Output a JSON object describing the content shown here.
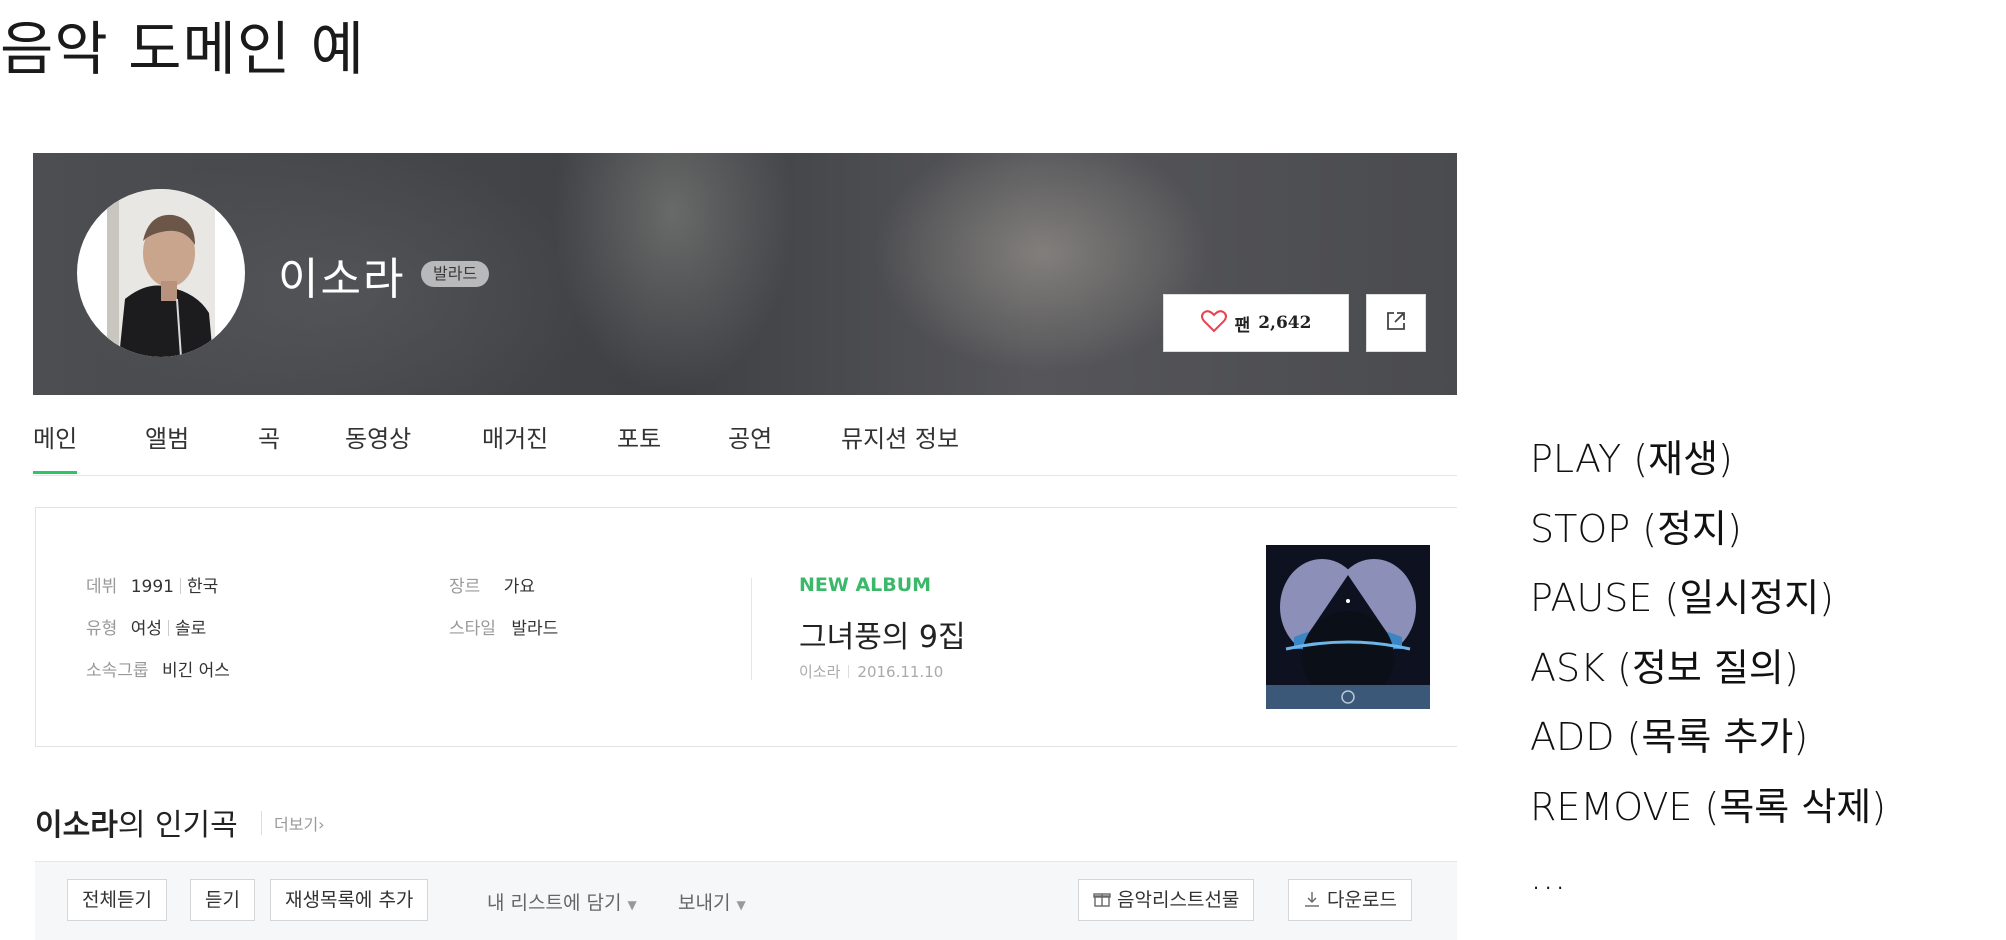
{
  "slide_title": "음악 도메인 예",
  "artist": {
    "name": "이소라",
    "genre_badge": "발라드",
    "fan_label": "팬",
    "fan_count": "2,642"
  },
  "tabs": [
    {
      "label": "메인",
      "active": true
    },
    {
      "label": "앨범"
    },
    {
      "label": "곡"
    },
    {
      "label": "동영상"
    },
    {
      "label": "매거진"
    },
    {
      "label": "포토"
    },
    {
      "label": "공연"
    },
    {
      "label": "뮤지션 정보"
    }
  ],
  "info": {
    "debut_label": "데뷔",
    "debut_year": "1991",
    "debut_country": "한국",
    "type_label": "유형",
    "type_gender": "여성",
    "type_kind": "솔로",
    "group_label": "소속그룹",
    "group_value": "비긴 어스",
    "genre_label": "장르",
    "genre_value": "가요",
    "style_label": "스타일",
    "style_value": "발라드"
  },
  "new_album": {
    "tag": "NEW ALBUM",
    "title": "그녀풍의 9집",
    "artist": "이소라",
    "date": "2016.11.10"
  },
  "popular": {
    "title_bold": "이소라",
    "title_rest": "의 인기곡",
    "more": "더보기›"
  },
  "toolbar": {
    "play_all": "전체듣기",
    "listen": "듣기",
    "add_playlist": "재생목록에 추가",
    "my_list": "내 리스트에 담기",
    "send": "보내기",
    "gift": "음악리스트선물",
    "download": "다운로드"
  },
  "commands": [
    "PLAY (재생)",
    "STOP (정지)",
    "PAUSE (일시정지)",
    "ASK (정보 질의)",
    "ADD (목록 추가)",
    "REMOVE (목록 삭제)",
    "..."
  ],
  "colors": {
    "accent_green": "#2cc66a",
    "heart_red": "#e8414f"
  }
}
